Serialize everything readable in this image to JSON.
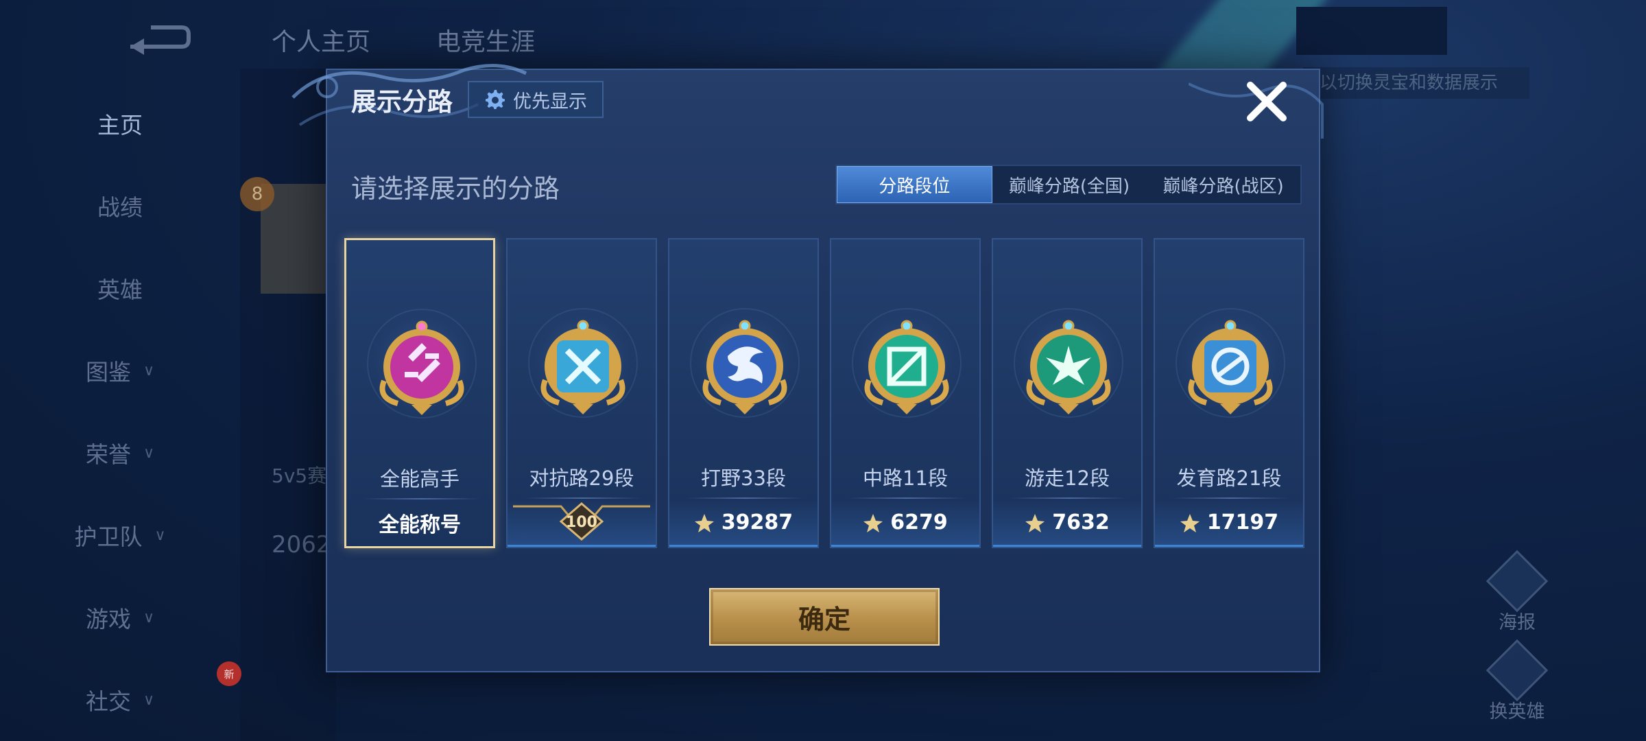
{
  "header": {
    "tabs": [
      "个人主页",
      "电竞生涯"
    ]
  },
  "sidebar": {
    "items": [
      {
        "label": "主页",
        "chevron": false,
        "active": true
      },
      {
        "label": "战绩",
        "chevron": false
      },
      {
        "label": "英雄",
        "chevron": false
      },
      {
        "label": "图鉴",
        "chevron": true
      },
      {
        "label": "荣誉",
        "chevron": true
      },
      {
        "label": "护卫队",
        "chevron": true
      },
      {
        "label": "游戏",
        "chevron": true
      },
      {
        "label": "社交",
        "chevron": true
      }
    ],
    "new_badge": "新"
  },
  "background": {
    "level": "8",
    "text_5v5": "5v5赛",
    "text_number": "2062",
    "hint": "以切换灵宝和数据展示"
  },
  "right_actions": {
    "poster": "海报",
    "switch_hero": "换英雄"
  },
  "modal": {
    "title": "展示分路",
    "priority_button": "优先显示",
    "subtitle": "请选择展示的分路",
    "tabs": [
      "分路段位",
      "巅峰分路(全国)",
      "巅峰分路(战区)"
    ],
    "active_tab": 0,
    "cards": [
      {
        "label": "全能高手",
        "footer": "全能称号",
        "selected": true,
        "color": "#c0359f"
      },
      {
        "label": "对抗路29段",
        "footer": "100",
        "color": "#39a8d8"
      },
      {
        "label": "打野33段",
        "footer": "39287",
        "color": "#2f5fb8"
      },
      {
        "label": "中路11段",
        "footer": "6279",
        "color": "#1fae8e"
      },
      {
        "label": "游走12段",
        "footer": "7632",
        "color": "#1c9a7a"
      },
      {
        "label": "发育路21段",
        "footer": "17197",
        "color": "#3a8fd6"
      }
    ],
    "confirm": "确定"
  },
  "colors": {
    "accent_blue": "#2d63b4",
    "gold": "#d9b775",
    "modal_bg": "#1d345d"
  }
}
